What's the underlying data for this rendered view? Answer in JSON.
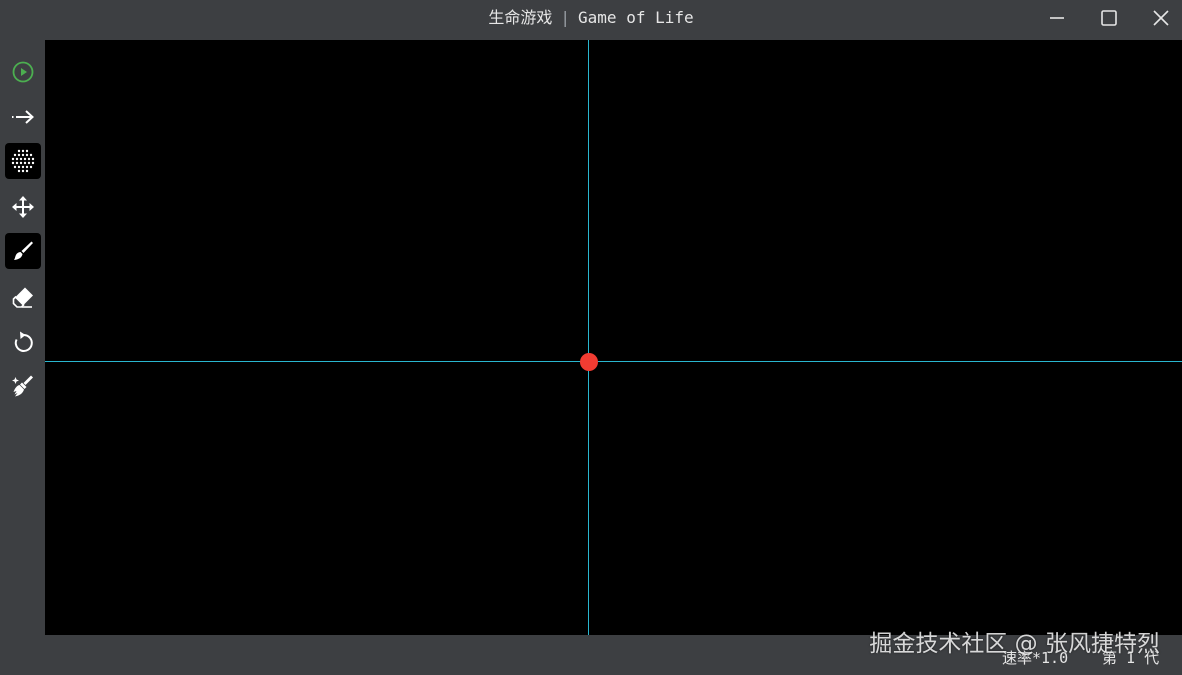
{
  "window": {
    "title_cn": "生命游戏",
    "title_separator": "|",
    "title_en": "Game of Life"
  },
  "window_controls": [
    "minimize-icon",
    "maximize-icon",
    "close-icon"
  ],
  "sidebar": {
    "tools": [
      {
        "name": "play",
        "icon": "play-circle-icon",
        "active": false,
        "color": "#4caf50"
      },
      {
        "name": "step",
        "icon": "arrow-right-icon",
        "active": false
      },
      {
        "name": "grid",
        "icon": "dot-grid-icon",
        "active": true
      },
      {
        "name": "move",
        "icon": "move-arrows-icon",
        "active": false
      },
      {
        "name": "brush",
        "icon": "brush-icon",
        "active": true
      },
      {
        "name": "eraser",
        "icon": "eraser-icon",
        "active": false
      },
      {
        "name": "reset",
        "icon": "refresh-icon",
        "active": false
      },
      {
        "name": "clear",
        "icon": "broom-icon",
        "active": false
      }
    ]
  },
  "canvas": {
    "background": "#000000",
    "axis_color": "#29b6cf",
    "origin_color": "#f23c32"
  },
  "status": {
    "speed": "速率*1.0",
    "generation": "第 1 代"
  },
  "watermark": "掘金技术社区 @ 张风捷特烈"
}
